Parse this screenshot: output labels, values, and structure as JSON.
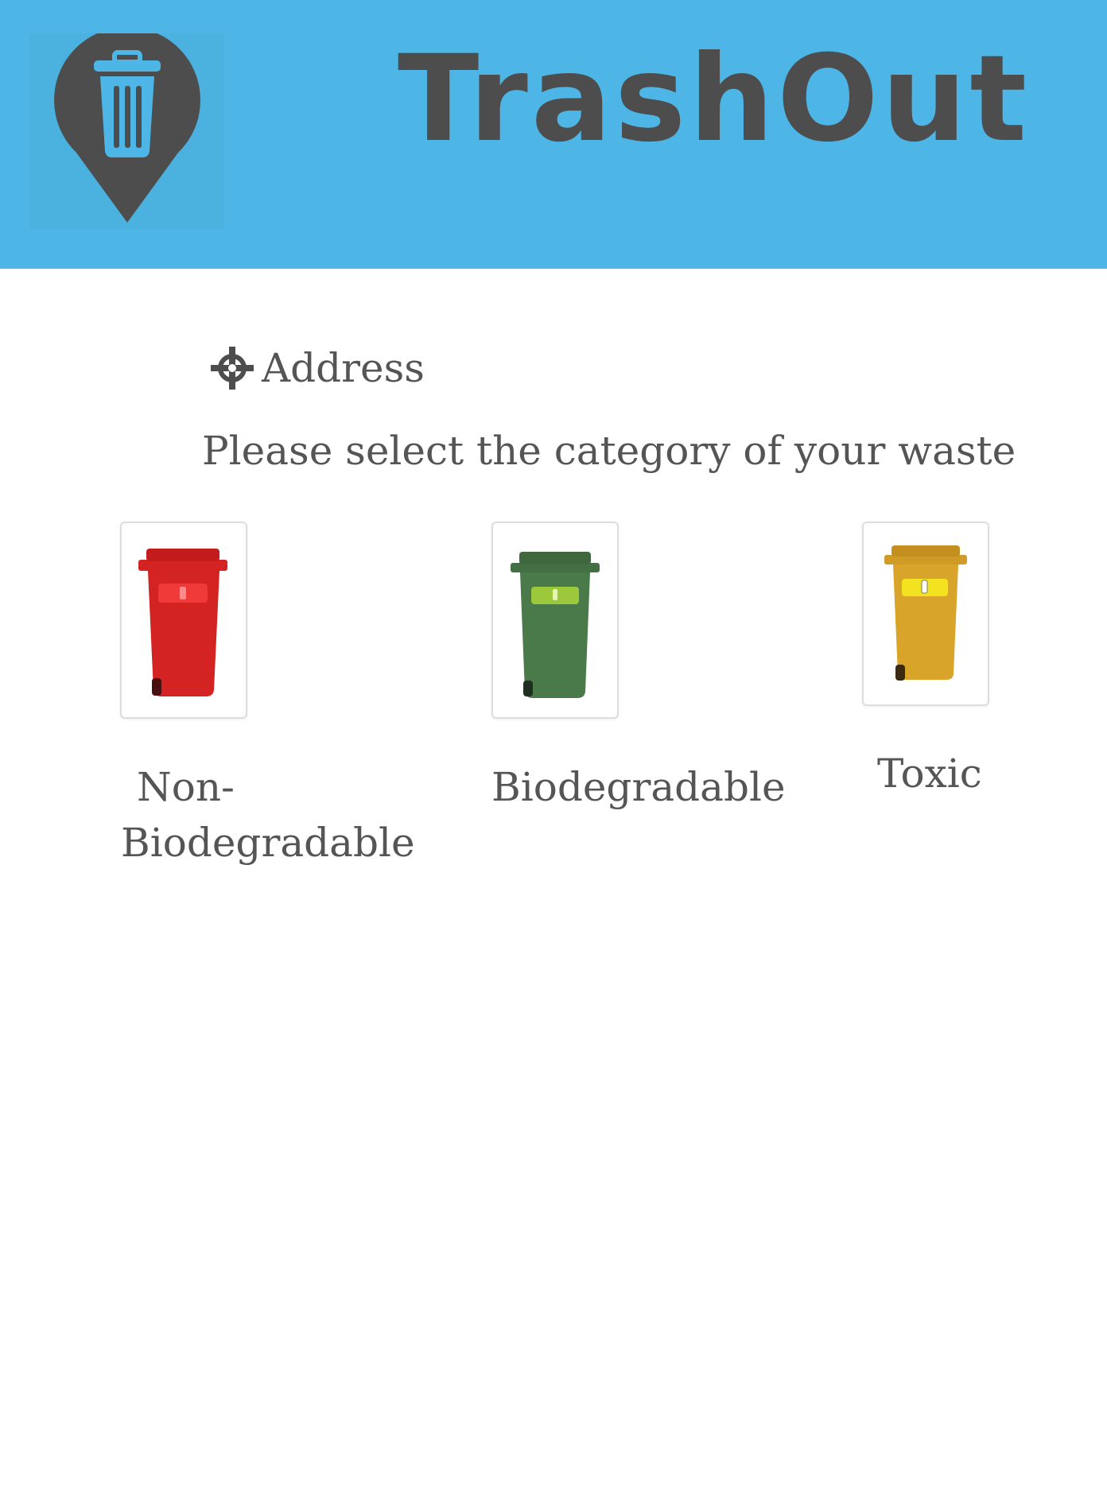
{
  "header": {
    "title": "TrashOut",
    "logo_icon": "map-pin-trash-icon",
    "background_color": "#4db6e6"
  },
  "address": {
    "icon": "crosshair-icon",
    "label": "Address"
  },
  "prompt": "Please select the category of your waste",
  "categories": [
    {
      "label_line1": "Non-",
      "label_line2": "Biodegradable",
      "bin_color": "#d42323",
      "icon": "red-bin-icon"
    },
    {
      "label": "Biodegradable",
      "bin_color": "#4a7a4a",
      "icon": "green-bin-icon"
    },
    {
      "label": "Toxic",
      "bin_color": "#d9a42a",
      "icon": "yellow-bin-icon"
    }
  ],
  "colors": {
    "text": "#555555",
    "dark_gray": "#4d4d4d"
  }
}
